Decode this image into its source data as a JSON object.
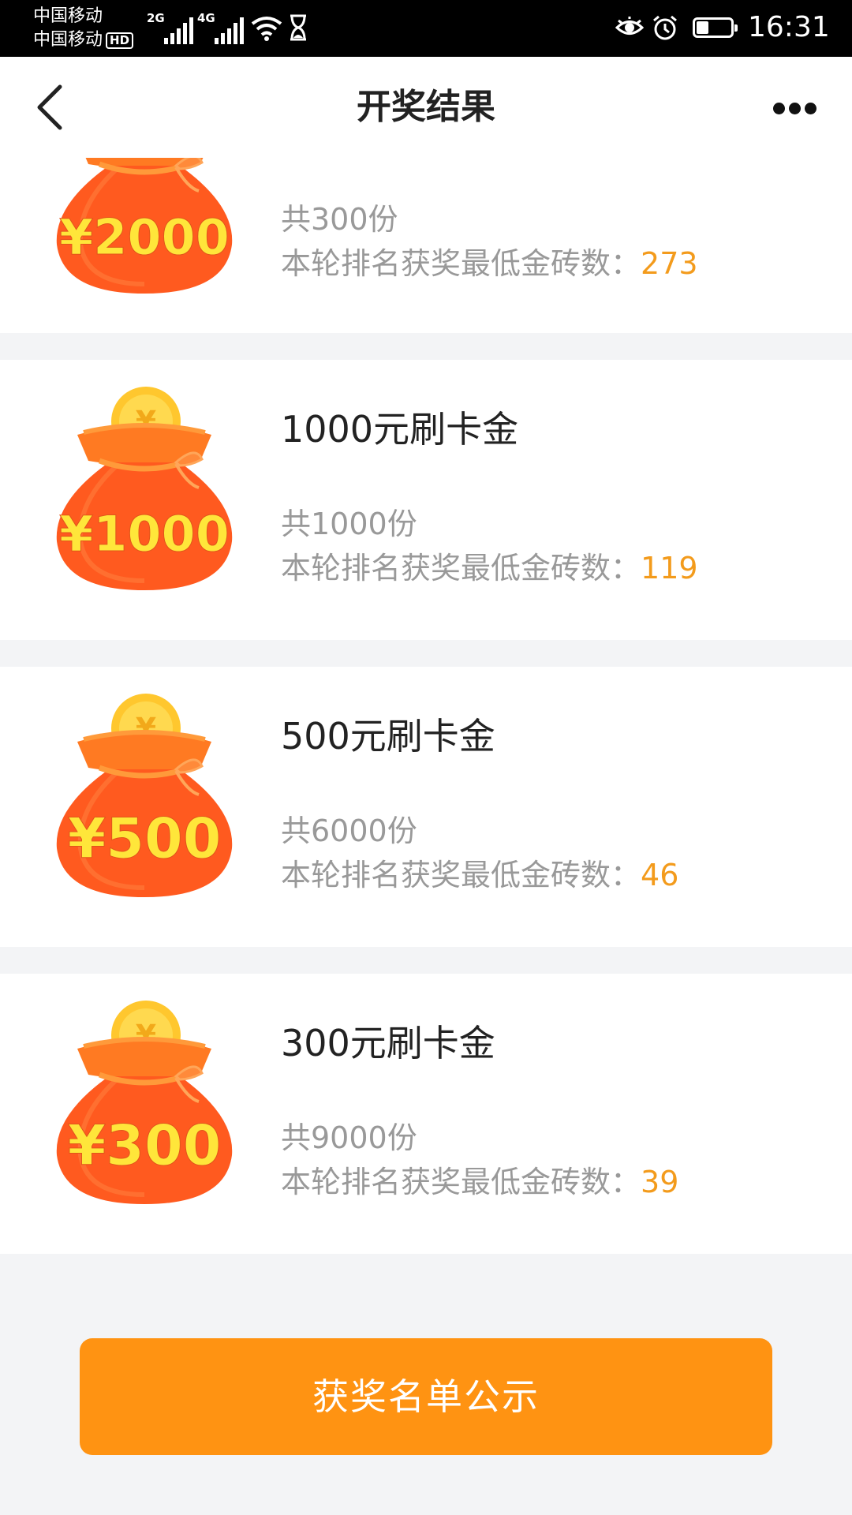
{
  "status_bar": {
    "carrier_1": "中国移动",
    "carrier_2": "中国移动",
    "hd_badge": "HD",
    "sim1_network": "2G",
    "sim2_network": "4G",
    "time": "16:31",
    "battery_level": 0.35,
    "icons": [
      "signal-icon",
      "wifi-icon",
      "hourglass-icon",
      "eye-icon",
      "alarm-icon",
      "battery-icon"
    ]
  },
  "header": {
    "title": "开奖结果",
    "back_icon": "chevron-left-icon",
    "more_icon": "more-icon"
  },
  "prizes": [
    {
      "bag_label": "¥2000",
      "name": "",
      "count_text": "共300份",
      "min_label": "本轮排名获奖最低金砖数：",
      "min_value": "273"
    },
    {
      "bag_label": "¥1000",
      "name": "1000元刷卡金",
      "count_text": "共1000份",
      "min_label": "本轮排名获奖最低金砖数：",
      "min_value": "119"
    },
    {
      "bag_label": "¥500",
      "name": "500元刷卡金",
      "count_text": "共6000份",
      "min_label": "本轮排名获奖最低金砖数：",
      "min_value": "46"
    },
    {
      "bag_label": "¥300",
      "name": "300元刷卡金",
      "count_text": "共9000份",
      "min_label": "本轮排名获奖最低金砖数：",
      "min_value": "39"
    }
  ],
  "footer": {
    "button_label": "获奖名单公示"
  },
  "colors": {
    "accent": "#ff9312",
    "highlight_number": "#f39b1c",
    "bag_orange": "#ff5a1f",
    "coin_yellow": "#ffd23a",
    "background": "#f3f4f6"
  }
}
